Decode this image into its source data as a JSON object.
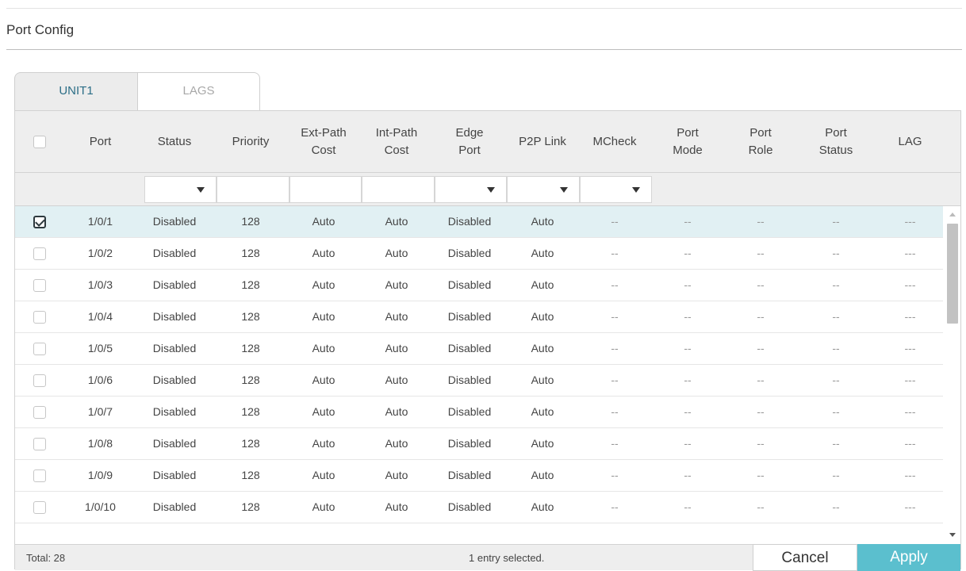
{
  "page": {
    "title": "Port Config"
  },
  "tabs": [
    {
      "label": "UNIT1",
      "active": true
    },
    {
      "label": "LAGS",
      "active": false
    }
  ],
  "columns": [
    "Port",
    "Status",
    "Priority",
    "Ext-Path\nCost",
    "Int-Path\nCost",
    "Edge\nPort",
    "P2P Link",
    "MCheck",
    "Port\nMode",
    "Port\nRole",
    "Port\nStatus",
    "LAG"
  ],
  "rows": [
    {
      "checked": true,
      "cells": [
        "1/0/1",
        "Disabled",
        "128",
        "Auto",
        "Auto",
        "Disabled",
        "Auto",
        "--",
        "--",
        "--",
        "--",
        "---"
      ]
    },
    {
      "checked": false,
      "cells": [
        "1/0/2",
        "Disabled",
        "128",
        "Auto",
        "Auto",
        "Disabled",
        "Auto",
        "--",
        "--",
        "--",
        "--",
        "---"
      ]
    },
    {
      "checked": false,
      "cells": [
        "1/0/3",
        "Disabled",
        "128",
        "Auto",
        "Auto",
        "Disabled",
        "Auto",
        "--",
        "--",
        "--",
        "--",
        "---"
      ]
    },
    {
      "checked": false,
      "cells": [
        "1/0/4",
        "Disabled",
        "128",
        "Auto",
        "Auto",
        "Disabled",
        "Auto",
        "--",
        "--",
        "--",
        "--",
        "---"
      ]
    },
    {
      "checked": false,
      "cells": [
        "1/0/5",
        "Disabled",
        "128",
        "Auto",
        "Auto",
        "Disabled",
        "Auto",
        "--",
        "--",
        "--",
        "--",
        "---"
      ]
    },
    {
      "checked": false,
      "cells": [
        "1/0/6",
        "Disabled",
        "128",
        "Auto",
        "Auto",
        "Disabled",
        "Auto",
        "--",
        "--",
        "--",
        "--",
        "---"
      ]
    },
    {
      "checked": false,
      "cells": [
        "1/0/7",
        "Disabled",
        "128",
        "Auto",
        "Auto",
        "Disabled",
        "Auto",
        "--",
        "--",
        "--",
        "--",
        "---"
      ]
    },
    {
      "checked": false,
      "cells": [
        "1/0/8",
        "Disabled",
        "128",
        "Auto",
        "Auto",
        "Disabled",
        "Auto",
        "--",
        "--",
        "--",
        "--",
        "---"
      ]
    },
    {
      "checked": false,
      "cells": [
        "1/0/9",
        "Disabled",
        "128",
        "Auto",
        "Auto",
        "Disabled",
        "Auto",
        "--",
        "--",
        "--",
        "--",
        "---"
      ]
    },
    {
      "checked": false,
      "cells": [
        "1/0/10",
        "Disabled",
        "128",
        "Auto",
        "Auto",
        "Disabled",
        "Auto",
        "--",
        "--",
        "--",
        "--",
        "---"
      ]
    }
  ],
  "footer": {
    "total": "Total: 28",
    "selected": "1 entry selected.",
    "cancel": "Cancel",
    "apply": "Apply"
  },
  "colors": {
    "accent": "#5bbfce",
    "selected_row": "#e1f0f3",
    "tab_active_text": "#2c6e87"
  }
}
